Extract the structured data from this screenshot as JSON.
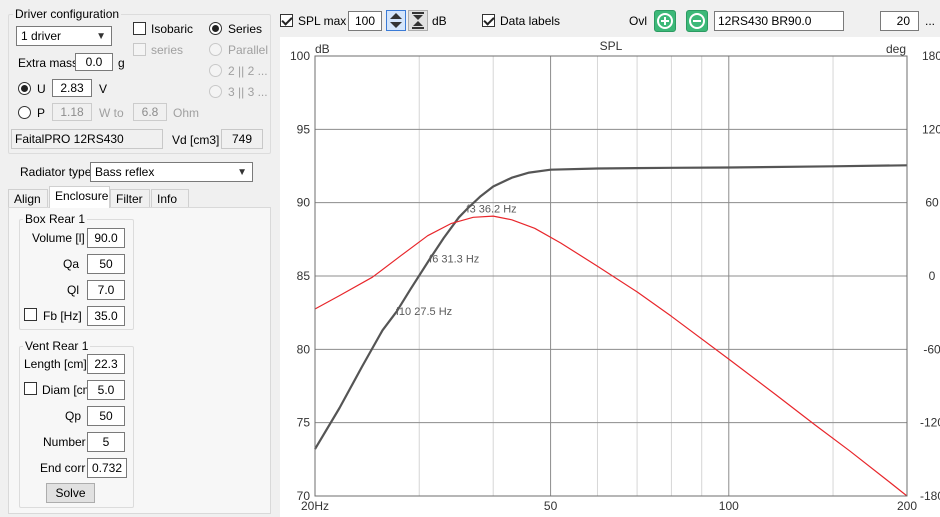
{
  "driver_config": {
    "title": "Driver configuration",
    "driver_count": "1 driver",
    "isobaric_label": "Isobaric",
    "series_sub_label": "series",
    "series_label": "Series",
    "parallel_label": "Parallel",
    "opt_22_label": "2 || 2 ...",
    "opt_33_label": "3 || 3 ...",
    "extra_mass_label": "Extra mass",
    "extra_mass_value": "0.0",
    "extra_mass_unit": "g",
    "u_label": "U",
    "u_value": "2.83",
    "u_unit": "V",
    "p_label": "P",
    "p_value": "1.18",
    "w_to_label": "W to",
    "ohm_value": "6.8",
    "ohm_unit": "Ohm",
    "driver_name": "FaitalPRO 12RS430",
    "vd_label": "Vd [cm3]",
    "vd_value": "749"
  },
  "radiator": {
    "label": "Radiator type",
    "value": "Bass reflex"
  },
  "tabs": [
    {
      "label": "Align"
    },
    {
      "label": "Enclosure"
    },
    {
      "label": "Filter"
    },
    {
      "label": "Info"
    }
  ],
  "box": {
    "title": "Box Rear 1",
    "volume_label": "Volume [l]",
    "volume_value": "90.0",
    "qa_label": "Qa",
    "qa_value": "50",
    "ql_label": "Ql",
    "ql_value": "7.0",
    "fb_label": "Fb [Hz]",
    "fb_value": "35.0"
  },
  "vent": {
    "title": "Vent Rear 1",
    "length_label": "Length [cm]",
    "length_value": "22.3",
    "diam_label": "Diam [cm]",
    "diam_value": "5.0",
    "qp_label": "Qp",
    "qp_value": "50",
    "number_label": "Number",
    "number_value": "5",
    "endcorr_label": "End corr",
    "endcorr_value": "0.732",
    "solve_label": "Solve"
  },
  "toolbar": {
    "spl_max_label": "SPL max",
    "spl_max_value": "100",
    "db_label": "dB",
    "data_labels_label": "Data labels",
    "ovl_label": "Ovl",
    "overlay_name": "12RS430 BR90.0",
    "count_value": "20",
    "more_label": "..."
  },
  "colors": {
    "spl_curve": "#555555",
    "phase_curve": "#e8262b",
    "accent_green": "#3cb878"
  },
  "chart_data": {
    "type": "line",
    "title": "SPL",
    "ylabel": "dB",
    "y2label": "deg",
    "x_scale": "log",
    "xlim": [
      20,
      200
    ],
    "ylim": [
      70,
      100
    ],
    "y2lim": [
      -180,
      180
    ],
    "x_ticks": [
      {
        "v": 20,
        "label": "20Hz"
      },
      {
        "v": 50,
        "label": "50"
      },
      {
        "v": 100,
        "label": "100"
      },
      {
        "v": 200,
        "label": "200"
      }
    ],
    "x_minor": [
      30,
      40,
      60,
      70,
      80,
      90,
      150
    ],
    "y_ticks": [
      70,
      75,
      80,
      85,
      90,
      95,
      100
    ],
    "y2_ticks": [
      -180,
      -120,
      -60,
      0,
      60,
      120,
      180
    ],
    "grid": true,
    "series": [
      {
        "axis": "y",
        "color": "#555555",
        "points": [
          [
            20,
            73.2
          ],
          [
            22,
            76.0
          ],
          [
            24,
            78.8
          ],
          [
            26,
            81.3
          ],
          [
            27.5,
            82.6
          ],
          [
            29,
            84.1
          ],
          [
            31.3,
            86.2
          ],
          [
            33,
            87.6
          ],
          [
            35,
            89.0
          ],
          [
            36.2,
            89.6
          ],
          [
            38,
            90.4
          ],
          [
            40,
            91.1
          ],
          [
            43,
            91.7
          ],
          [
            46,
            92.05
          ],
          [
            50,
            92.25
          ],
          [
            60,
            92.33
          ],
          [
            80,
            92.38
          ],
          [
            100,
            92.4
          ],
          [
            150,
            92.48
          ],
          [
            200,
            92.55
          ]
        ]
      },
      {
        "axis": "y2",
        "color": "#e8262b",
        "points": [
          [
            20,
            -27
          ],
          [
            22,
            -16
          ],
          [
            25,
            -1
          ],
          [
            28,
            17
          ],
          [
            31,
            33
          ],
          [
            34,
            43
          ],
          [
            37,
            48
          ],
          [
            40,
            49
          ],
          [
            43,
            46
          ],
          [
            47,
            39
          ],
          [
            52,
            27
          ],
          [
            60,
            8
          ],
          [
            70,
            -13
          ],
          [
            80,
            -33
          ],
          [
            100,
            -68
          ],
          [
            120,
            -97
          ],
          [
            140,
            -122
          ],
          [
            160,
            -143
          ],
          [
            185,
            -167
          ],
          [
            200,
            -180
          ]
        ]
      }
    ],
    "annotations": [
      {
        "label": "f3 36.2 Hz",
        "x": 36.2,
        "y": 89.6
      },
      {
        "label": "f6 31.3 Hz",
        "x": 31.3,
        "y": 86.2
      },
      {
        "label": "f10 27.5 Hz",
        "x": 27.5,
        "y": 82.6
      }
    ]
  }
}
